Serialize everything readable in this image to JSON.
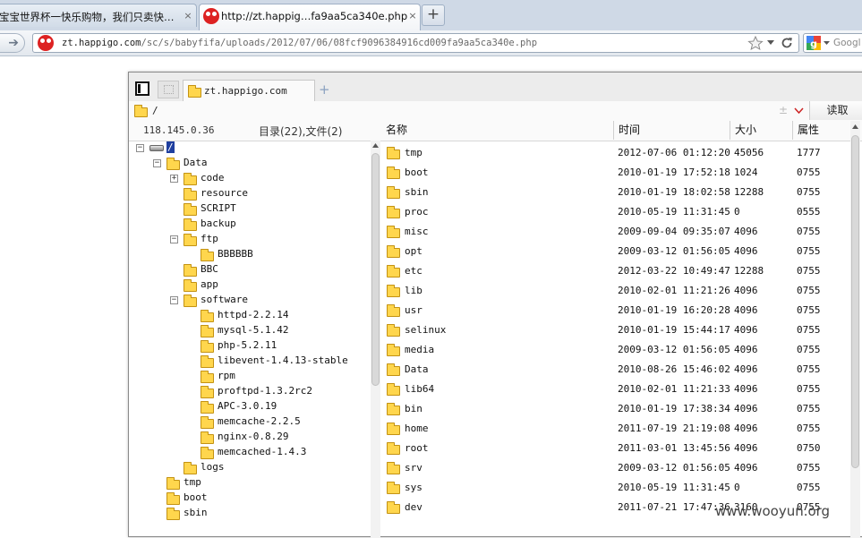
{
  "browser": {
    "tabs": [
      {
        "title": "宝宝世界杯一快乐购物，我们只卖快…",
        "active": false
      },
      {
        "title": "http://zt.happig…fa9aa5ca340e.php",
        "active": true
      }
    ],
    "close_glyph": "×",
    "new_tab_glyph": "+",
    "url_host": "zt.happigo.com",
    "url_path": "/sc/s/babyfifa/uploads/2012/07/06/08fcf9096384916cd009fa9aa5ca340e.php",
    "search_placeholder": "Googl"
  },
  "file_manager": {
    "tab_label": "zt.happigo.com",
    "add_tab_glyph": "+",
    "path": "/",
    "read_button": "读取",
    "server_ip": "118.145.0.36",
    "summary": "目录(22),文件(2)",
    "columns": {
      "name": "名称",
      "time": "时间",
      "size": "大小",
      "attr": "属性"
    },
    "tree": [
      {
        "label": "/",
        "depth": 0,
        "toggle": "−",
        "kind": "root"
      },
      {
        "label": "Data",
        "depth": 1,
        "toggle": "−"
      },
      {
        "label": "code",
        "depth": 2,
        "toggle": "+"
      },
      {
        "label": "resource",
        "depth": 2
      },
      {
        "label": "SCRIPT",
        "depth": 2
      },
      {
        "label": "backup",
        "depth": 2
      },
      {
        "label": "ftp",
        "depth": 2,
        "toggle": "−"
      },
      {
        "label": "BBBBBB",
        "depth": 3
      },
      {
        "label": "BBC",
        "depth": 2
      },
      {
        "label": "app",
        "depth": 2
      },
      {
        "label": "software",
        "depth": 2,
        "toggle": "−"
      },
      {
        "label": "httpd-2.2.14",
        "depth": 3
      },
      {
        "label": "mysql-5.1.42",
        "depth": 3
      },
      {
        "label": "php-5.2.11",
        "depth": 3
      },
      {
        "label": "libevent-1.4.13-stable",
        "depth": 3
      },
      {
        "label": "rpm",
        "depth": 3
      },
      {
        "label": "proftpd-1.3.2rc2",
        "depth": 3
      },
      {
        "label": "APC-3.0.19",
        "depth": 3
      },
      {
        "label": "memcache-2.2.5",
        "depth": 3
      },
      {
        "label": "nginx-0.8.29",
        "depth": 3
      },
      {
        "label": "memcached-1.4.3",
        "depth": 3
      },
      {
        "label": "logs",
        "depth": 2
      },
      {
        "label": "tmp",
        "depth": 1
      },
      {
        "label": "boot",
        "depth": 1
      },
      {
        "label": "sbin",
        "depth": 1
      }
    ],
    "files": [
      {
        "name": "tmp",
        "time": "2012-07-06 01:12:20",
        "size": "45056",
        "attr": "1777"
      },
      {
        "name": "boot",
        "time": "2010-01-19 17:52:18",
        "size": "1024",
        "attr": "0755"
      },
      {
        "name": "sbin",
        "time": "2010-01-19 18:02:58",
        "size": "12288",
        "attr": "0755"
      },
      {
        "name": "proc",
        "time": "2010-05-19 11:31:45",
        "size": "0",
        "attr": "0555"
      },
      {
        "name": "misc",
        "time": "2009-09-04 09:35:07",
        "size": "4096",
        "attr": "0755"
      },
      {
        "name": "opt",
        "time": "2009-03-12 01:56:05",
        "size": "4096",
        "attr": "0755"
      },
      {
        "name": "etc",
        "time": "2012-03-22 10:49:47",
        "size": "12288",
        "attr": "0755"
      },
      {
        "name": "lib",
        "time": "2010-02-01 11:21:26",
        "size": "4096",
        "attr": "0755"
      },
      {
        "name": "usr",
        "time": "2010-01-19 16:20:28",
        "size": "4096",
        "attr": "0755"
      },
      {
        "name": "selinux",
        "time": "2010-01-19 15:44:17",
        "size": "4096",
        "attr": "0755"
      },
      {
        "name": "media",
        "time": "2009-03-12 01:56:05",
        "size": "4096",
        "attr": "0755"
      },
      {
        "name": "Data",
        "time": "2010-08-26 15:46:02",
        "size": "4096",
        "attr": "0755"
      },
      {
        "name": "lib64",
        "time": "2010-02-01 11:21:33",
        "size": "4096",
        "attr": "0755"
      },
      {
        "name": "bin",
        "time": "2010-01-19 17:38:34",
        "size": "4096",
        "attr": "0755"
      },
      {
        "name": "home",
        "time": "2011-07-19 21:19:08",
        "size": "4096",
        "attr": "0755"
      },
      {
        "name": "root",
        "time": "2011-03-01 13:45:56",
        "size": "4096",
        "attr": "0750"
      },
      {
        "name": "srv",
        "time": "2009-03-12 01:56:05",
        "size": "4096",
        "attr": "0755"
      },
      {
        "name": "sys",
        "time": "2010-05-19 11:31:45",
        "size": "0",
        "attr": "0755"
      },
      {
        "name": "dev",
        "time": "2011-07-21 17:47:36",
        "size": "3160",
        "attr": "0755"
      }
    ]
  },
  "watermark": "www.wooyun.org",
  "colors": {
    "folder": "#ffd64d",
    "selection": "#1f3f9f",
    "logo": "#dd2222"
  }
}
